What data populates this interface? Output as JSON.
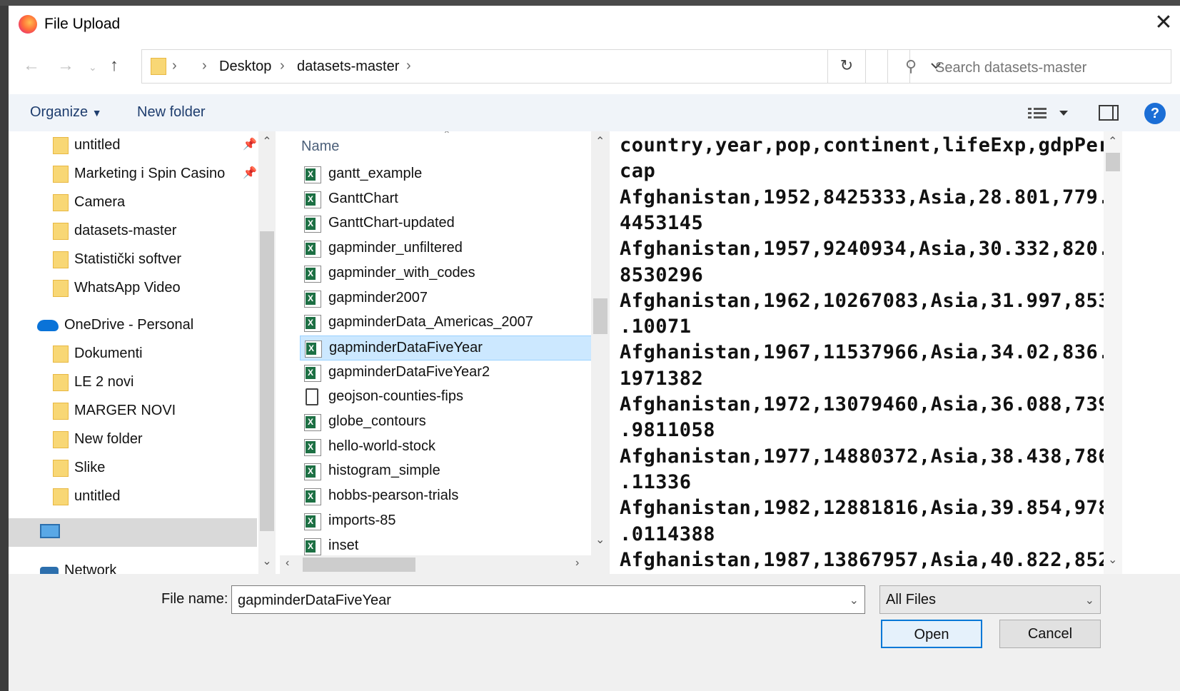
{
  "window": {
    "title": "File Upload"
  },
  "address": {
    "crumbs": [
      "Desktop",
      "datasets-master"
    ]
  },
  "search": {
    "placeholder": "Search datasets-master"
  },
  "toolbar": {
    "organize": "Organize",
    "new_folder": "New folder"
  },
  "nav": {
    "items": [
      {
        "label": "untitled",
        "pinned": true
      },
      {
        "label": "Marketing i Spin Casino",
        "pinned": true
      },
      {
        "label": "Camera"
      },
      {
        "label": "datasets-master"
      },
      {
        "label": "Statistički softver"
      },
      {
        "label": "WhatsApp Video"
      }
    ],
    "onedrive": "OneDrive - Personal",
    "onedrive_items": [
      "Dokumenti",
      "LE 2 novi",
      "MARGER NOVI",
      "New folder",
      "Slike",
      "untitled"
    ],
    "network": "Network"
  },
  "files": {
    "column_name": "Name",
    "rows": [
      {
        "name": "gantt_example",
        "icon": "excel-csv-icon"
      },
      {
        "name": "GanttChart",
        "icon": "excel-csv-icon"
      },
      {
        "name": "GanttChart-updated",
        "icon": "excel-csv-icon"
      },
      {
        "name": "gapminder_unfiltered",
        "icon": "excel-csv-icon"
      },
      {
        "name": "gapminder_with_codes",
        "icon": "excel-csv-icon"
      },
      {
        "name": "gapminder2007",
        "icon": "excel-csv-icon"
      },
      {
        "name": "gapminderData_Americas_2007",
        "icon": "excel-csv-icon"
      },
      {
        "name": "gapminderDataFiveYear",
        "icon": "excel-csv-icon",
        "selected": true
      },
      {
        "name": "gapminderDataFiveYear2",
        "icon": "excel-csv-icon"
      },
      {
        "name": "geojson-counties-fips",
        "icon": "generic-file-icon"
      },
      {
        "name": "globe_contours",
        "icon": "excel-csv-icon"
      },
      {
        "name": "hello-world-stock",
        "icon": "excel-csv-icon"
      },
      {
        "name": "histogram_simple",
        "icon": "excel-csv-icon"
      },
      {
        "name": "hobbs-pearson-trials",
        "icon": "excel-csv-icon"
      },
      {
        "name": "imports-85",
        "icon": "excel-csv-icon"
      },
      {
        "name": "inset",
        "icon": "excel-csv-icon"
      }
    ]
  },
  "preview": {
    "lines": [
      "country,year,pop,continent,lifeExp,gdpPer",
      "cap",
      "Afghanistan,1952,8425333,Asia,28.801,779.",
      "4453145",
      "Afghanistan,1957,9240934,Asia,30.332,820.",
      "8530296",
      "Afghanistan,1962,10267083,Asia,31.997,853",
      ".10071",
      "Afghanistan,1967,11537966,Asia,34.02,836.",
      "1971382",
      "Afghanistan,1972,13079460,Asia,36.088,739",
      ".9811058",
      "Afghanistan,1977,14880372,Asia,38.438,786",
      ".11336",
      "Afghanistan,1982,12881816,Asia,39.854,978",
      ".0114388",
      "Afghanistan,1987,13867957,Asia,40.822,852"
    ]
  },
  "bottom": {
    "file_name_label": "File name:",
    "file_name_value": "gapminderDataFiveYear",
    "file_type": "All Files",
    "open": "Open",
    "cancel": "Cancel"
  },
  "colors": {
    "selection": "#cce8ff",
    "accent": "#0078d7",
    "toolbar_bg": "#f0f4f9"
  }
}
